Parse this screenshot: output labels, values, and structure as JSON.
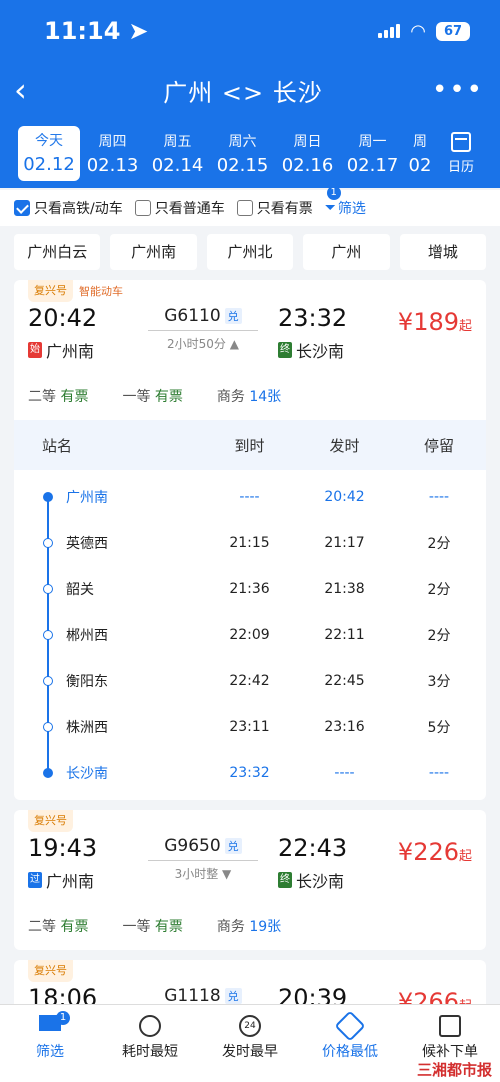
{
  "status": {
    "time": "11:14",
    "battery": "67"
  },
  "header": {
    "title": "广州 <> 长沙"
  },
  "dates": [
    {
      "weekday": "今天",
      "date": "02.12"
    },
    {
      "weekday": "周四",
      "date": "02.13"
    },
    {
      "weekday": "周五",
      "date": "02.14"
    },
    {
      "weekday": "周六",
      "date": "02.15"
    },
    {
      "weekday": "周日",
      "date": "02.16"
    },
    {
      "weekday": "周一",
      "date": "02.17"
    },
    {
      "weekday": "周",
      "date": "02"
    }
  ],
  "calendar_label": "日历",
  "filters": {
    "gaotie": "只看高铁/动车",
    "putong": "只看普通车",
    "youpiao": "只看有票",
    "screen": "筛选",
    "screen_badge": "1"
  },
  "stations": [
    "广州白云",
    "广州南",
    "广州北",
    "广州",
    "增城"
  ],
  "trains": [
    {
      "tag": "复兴号",
      "tag2": "智能动车",
      "dep_time": "20:42",
      "dep_mark": "始",
      "dep_station": "广州南",
      "number": "G6110",
      "dui": "兑",
      "duration": "2小时50分 ▲",
      "arr_time": "23:32",
      "arr_mark": "终",
      "arr_station": "长沙南",
      "price": "¥189",
      "price_suffix": "起",
      "seats": [
        {
          "cls": "二等",
          "st": "有票"
        },
        {
          "cls": "一等",
          "st": "有票"
        },
        {
          "cls": "商务",
          "st": "14张"
        }
      ]
    },
    {
      "tag": "复兴号",
      "dep_time": "19:43",
      "dep_mark": "过",
      "dep_station": "广州南",
      "number": "G9650",
      "dui": "兑",
      "duration": "3小时整 ▼",
      "arr_time": "22:43",
      "arr_mark": "终",
      "arr_station": "长沙南",
      "price": "¥226",
      "price_suffix": "起",
      "seats": [
        {
          "cls": "二等",
          "st": "有票"
        },
        {
          "cls": "一等",
          "st": "有票"
        },
        {
          "cls": "商务",
          "st": "19张"
        }
      ]
    },
    {
      "tag": "复兴号",
      "dep_time": "18:06",
      "number": "G1118",
      "dui": "兑",
      "arr_time": "20:39",
      "price": "¥266",
      "price_suffix": "起"
    }
  ],
  "schedule": {
    "headers": {
      "name": "站名",
      "arr": "到时",
      "dep": "发时",
      "stop": "停留"
    },
    "rows": [
      {
        "name": "广州南",
        "arr": "----",
        "dep": "20:42",
        "stop": "----"
      },
      {
        "name": "英德西",
        "arr": "21:15",
        "dep": "21:17",
        "stop": "2分"
      },
      {
        "name": "韶关",
        "arr": "21:36",
        "dep": "21:38",
        "stop": "2分"
      },
      {
        "name": "郴州西",
        "arr": "22:09",
        "dep": "22:11",
        "stop": "2分"
      },
      {
        "name": "衡阳东",
        "arr": "22:42",
        "dep": "22:45",
        "stop": "3分"
      },
      {
        "name": "株洲西",
        "arr": "23:11",
        "dep": "23:16",
        "stop": "5分"
      },
      {
        "name": "长沙南",
        "arr": "23:32",
        "dep": "----",
        "stop": "----"
      }
    ]
  },
  "bottom": {
    "screen": "筛选",
    "screen_badge": "1",
    "fastest": "耗时最短",
    "earliest": "发时最早",
    "earliest_icon": "24",
    "cheapest": "价格最低",
    "waitlist": "候补下单"
  },
  "watermark": "三湘都市报"
}
